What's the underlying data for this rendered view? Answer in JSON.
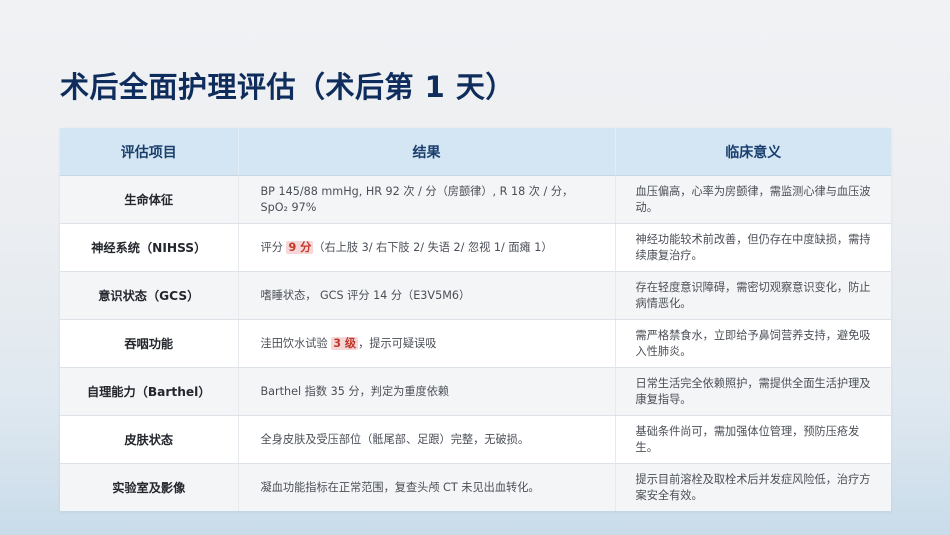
{
  "slide": {
    "title": "术后全面护理评估（术后第 1 天）"
  },
  "table": {
    "headers": [
      "评估项目",
      "结果",
      "临床意义"
    ],
    "rows": [
      {
        "item": "生命体征",
        "result_pre": "BP 145/88 mmHg, HR 92 次 / 分（房颤律）, R 18 次 / 分，SpO₂ 97%",
        "result_hl": "",
        "result_post": "",
        "meaning": "血压偏高，心率为房颤律，需监测心律与血压波动。"
      },
      {
        "item": "神经系统（NIHSS）",
        "result_pre": "评分 ",
        "result_hl": "9 分",
        "result_post": "（右上肢 3/ 右下肢 2/ 失语 2/ 忽视 1/ 面瘫 1）",
        "meaning": "神经功能较术前改善，但仍存在中度缺损，需持续康复治疗。"
      },
      {
        "item": "意识状态（GCS）",
        "result_pre": "嗜睡状态， GCS 评分  14 分（E3V5M6）",
        "result_hl": "",
        "result_post": "",
        "meaning": "存在轻度意识障碍，需密切观察意识变化，防止病情恶化。"
      },
      {
        "item": "吞咽功能",
        "result_pre": "洼田饮水试验 ",
        "result_hl": "3 级",
        "result_post": "，提示可疑误吸",
        "meaning": "需严格禁食水，立即给予鼻饲营养支持，避免吸入性肺炎。"
      },
      {
        "item": "自理能力（Barthel）",
        "result_pre": "Barthel 指数  35 分，判定为重度依赖",
        "result_hl": "",
        "result_post": "",
        "meaning": "日常生活完全依赖照护，需提供全面生活护理及康复指导。"
      },
      {
        "item": "皮肤状态",
        "result_pre": "全身皮肤及受压部位（骶尾部、足跟）完整，无破损。",
        "result_hl": "",
        "result_post": "",
        "meaning": "基础条件尚可，需加强体位管理，预防压疮发生。"
      },
      {
        "item": "实验室及影像",
        "result_pre": "凝血功能指标在正常范围，复查头颅 CT 未见出血转化。",
        "result_hl": "",
        "result_post": "",
        "meaning": "提示目前溶栓及取栓术后并发症风险低，治疗方案安全有效。"
      }
    ]
  },
  "colors": {
    "title": "#0f2d5c",
    "header_bg": "#d4e6f3",
    "header_text": "#1a3e6e",
    "highlight_bg": "#f6d6d6",
    "highlight_text": "#c0392b"
  }
}
